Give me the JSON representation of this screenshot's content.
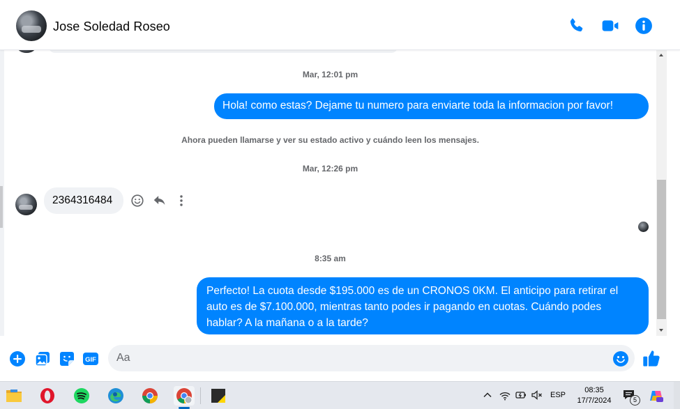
{
  "header": {
    "contact_name": "Jose Soledad Roseo",
    "icons": [
      "phone-icon",
      "video-camera-icon",
      "info-icon"
    ]
  },
  "conversation": {
    "timestamps": [
      "Mar, 12:01 pm",
      "Mar, 12:26 pm",
      "8:35 am"
    ],
    "system_notice": "Ahora pueden llamarse y ver su estado activo y cuándo leen los mensajes.",
    "messages": [
      {
        "direction": "outgoing",
        "text": "Hola! como estas? Dejame tu numero para enviarte toda la informacion por favor!"
      },
      {
        "direction": "incoming",
        "text": "2364316484"
      },
      {
        "direction": "outgoing",
        "text": "Perfecto! La cuota desde $195.000 es de un CRONOS 0KM. El anticipo para retirar el auto es de $7.100.000, mientras tanto podes ir pagando en cuotas. Cuándo podes hablar? A la mañana o a la tarde?"
      }
    ],
    "message_actions": [
      "smile-react-icon",
      "reply-icon",
      "more-vertical-icon"
    ]
  },
  "composer": {
    "placeholder": "Aa",
    "value": "",
    "icons": [
      "plus-circle-icon",
      "photo-icon",
      "sticker-icon",
      "gif-icon",
      "emoji-icon",
      "thumbs-up-icon"
    ],
    "gif_label": "GIF"
  },
  "taskbar": {
    "apps": [
      "file-explorer-icon",
      "opera-icon",
      "spotify-icon",
      "edge-icon",
      "chrome-icon",
      "chrome-profile-icon",
      "sticky-notes-icon"
    ],
    "language": "ESP",
    "time": "08:35",
    "date": "17/7/2024",
    "notification_count": "5"
  },
  "colors": {
    "accent": "#0084ff",
    "bubble_incoming": "#f0f2f5",
    "meta_text": "#65676b",
    "taskbar": "#e5e8ee"
  }
}
